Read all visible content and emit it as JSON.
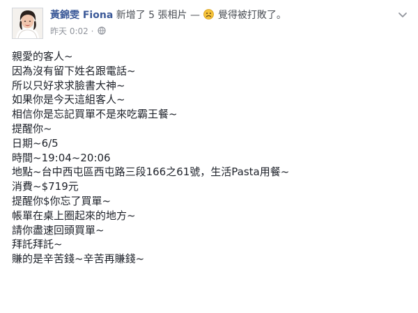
{
  "post": {
    "author": "黃錦雯 Fiona",
    "action": "新增了 5 張相片",
    "dash": "—",
    "feeling_icon": "sad-face-icon",
    "feeling": "覺得被打敗了。",
    "timestamp": "昨天 0:02",
    "audience_icon": "globe-icon",
    "menu_icon": "chevron-down-icon",
    "message_lines": [
      "親愛的客人~",
      "因為沒有留下姓名跟電話~",
      "所以只好求求臉書大神~",
      "如果你是今天這組客人~",
      "相信你是忘記買單不是來吃霸王餐~",
      "提醒你~",
      "日期~6/5",
      "時間~19:04~20:06",
      "地點~台中西屯區西屯路三段166之61號，生活Pasta用餐~",
      "消費~$719元",
      "提醒你$你忘了買單~",
      "帳單在桌上圈起來的地方~",
      "請你盡速回頭買單~",
      "拜託拜託~",
      "賺的是辛苦錢~辛苦再賺錢~"
    ]
  },
  "colors": {
    "author_link": "#3b5998",
    "meta_text": "#90949c",
    "body_text": "#1d2129",
    "feeling_icon": "#f5c33b"
  }
}
